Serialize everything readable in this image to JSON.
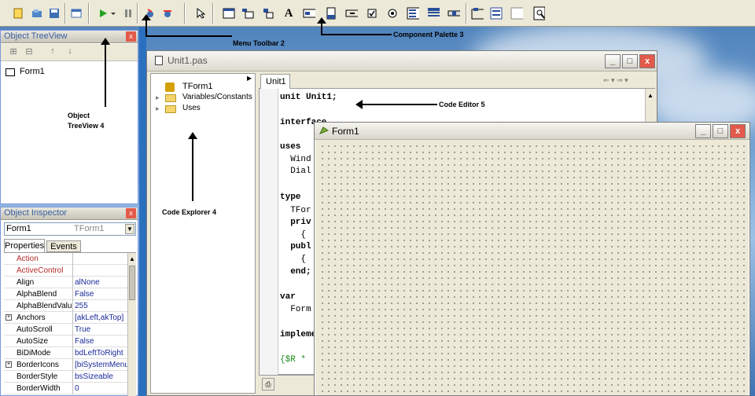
{
  "toolbar": {
    "text_tool_label": "A",
    "run_icon": "play-icon",
    "pause_icon": "pause-icon"
  },
  "object_treeview": {
    "title": "Object TreeView",
    "close": "x",
    "root_item": "Form1"
  },
  "object_inspector": {
    "title": "Object Inspector",
    "close": "x",
    "selected_component": "Form1",
    "selected_class": "TForm1",
    "tabs": [
      "Properties",
      "Events"
    ],
    "properties": [
      {
        "name": "Action",
        "value": "",
        "style": "red"
      },
      {
        "name": "ActiveControl",
        "value": "",
        "style": "red"
      },
      {
        "name": "Align",
        "value": "alNone",
        "style": "normal"
      },
      {
        "name": "AlphaBlend",
        "value": "False",
        "style": "normal"
      },
      {
        "name": "AlphaBlendValue",
        "value": "255",
        "style": "normal"
      },
      {
        "name": "Anchors",
        "value": "[akLeft,akTop]",
        "style": "expand"
      },
      {
        "name": "AutoScroll",
        "value": "True",
        "style": "normal"
      },
      {
        "name": "AutoSize",
        "value": "False",
        "style": "normal"
      },
      {
        "name": "BiDiMode",
        "value": "bdLeftToRight",
        "style": "normal"
      },
      {
        "name": "BorderIcons",
        "value": "[biSystemMenu]",
        "style": "expand"
      },
      {
        "name": "BorderStyle",
        "value": "bsSizeable",
        "style": "normal"
      },
      {
        "name": "BorderWidth",
        "value": "0",
        "style": "normal"
      }
    ]
  },
  "code_window": {
    "title": "Unit1.pas",
    "tab": "Unit1",
    "explorer_items": [
      "TForm1",
      "Variables/Constants",
      "Uses"
    ],
    "code_lines": [
      {
        "text": "unit Unit1;"
      },
      {
        "text": "interface"
      },
      {
        "text": "uses"
      },
      {
        "text": "  Wind"
      },
      {
        "text": "  Dial"
      },
      {
        "text": "type"
      },
      {
        "text": "  TFor"
      },
      {
        "text": "  priv"
      },
      {
        "text": "    {"
      },
      {
        "text": "  publ"
      },
      {
        "text": "    {"
      },
      {
        "text": "  end;"
      },
      {
        "text": "var"
      },
      {
        "text": "  Form"
      },
      {
        "text": "implementation"
      },
      {
        "text": "{$R *"
      }
    ]
  },
  "form_designer": {
    "title": "Form1",
    "minimize": "_",
    "maximize": "□",
    "close": "x"
  },
  "annotations": {
    "menu": "Menu Toolbar",
    "menu_num": "2",
    "palette": "Component Palette",
    "palette_num": "3",
    "treeview": "Object",
    "treeview2": "TreeView",
    "treeview_num": "4",
    "explorer": "Code Explorer",
    "explorer_num": "4",
    "editor": "Code Editor",
    "editor_num": "5"
  }
}
